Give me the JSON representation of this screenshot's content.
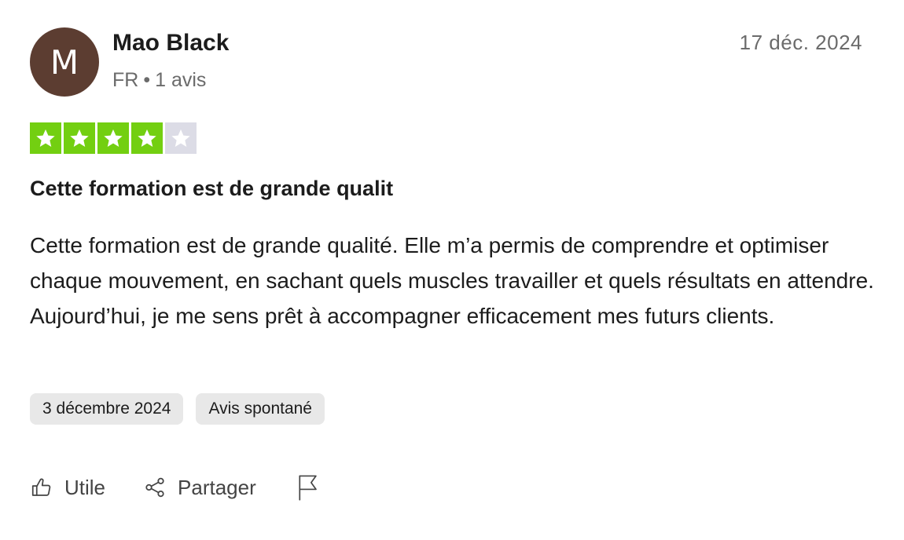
{
  "review": {
    "author": {
      "initial": "M",
      "name": "Mao Black",
      "country": "FR",
      "separator": "•",
      "review_count": "1 avis",
      "avatar_color": "#5c3d31"
    },
    "published_date": "17 déc. 2024",
    "rating": {
      "value": 4,
      "max": 5,
      "on_color": "#73cf11",
      "off_color": "#dcdce6"
    },
    "title": "Cette formation est de grande qualit",
    "text": "Cette formation est de grande qualité. Elle m’a permis de comprendre et optimiser chaque mouvement, en sachant quels muscles travailler et quels résultats en attendre. Aujourd’hui, je me sens prêt à accompagner efficacement mes futurs clients.",
    "tags": [
      "3 décembre 2024",
      "Avis spontané"
    ],
    "actions": {
      "useful": {
        "label": "Utile",
        "icon": "thumbs-up-icon"
      },
      "share": {
        "label": "Partager",
        "icon": "share-icon"
      },
      "report": {
        "icon": "flag-icon"
      }
    }
  }
}
